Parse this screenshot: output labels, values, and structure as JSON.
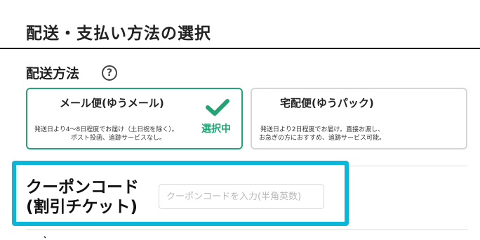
{
  "header": {
    "title": "配送・支払い方法の選択"
  },
  "shipping": {
    "section_title": "配送方法",
    "help_icon": "question-circle-icon",
    "options": [
      {
        "name": "メール便(ゆうメール)",
        "desc_line1": "発送日より4〜8日程度でお届け（土日祝を除く）。",
        "desc_line2": "ポスト投函、追跡サービスなし。",
        "selected": true,
        "selected_label": "選択中",
        "selected_icon": "checkmark-icon"
      },
      {
        "name": "宅配便(ゆうパック)",
        "desc_line1": "発送日より2日程度でお届け。直接お渡し、",
        "desc_line2": "お急ぎの方におすすめ、追跡サービス可能。",
        "selected": false
      }
    ]
  },
  "coupon": {
    "title_line1": "クーポンコード",
    "title_line2": "(割引チケット)",
    "placeholder": "クーポンコードを入力(半角英数)",
    "value": ""
  },
  "colors": {
    "accent_green": "#24a476",
    "highlight_border": "#0ab7d8",
    "card_border": "#d5d5d5"
  }
}
